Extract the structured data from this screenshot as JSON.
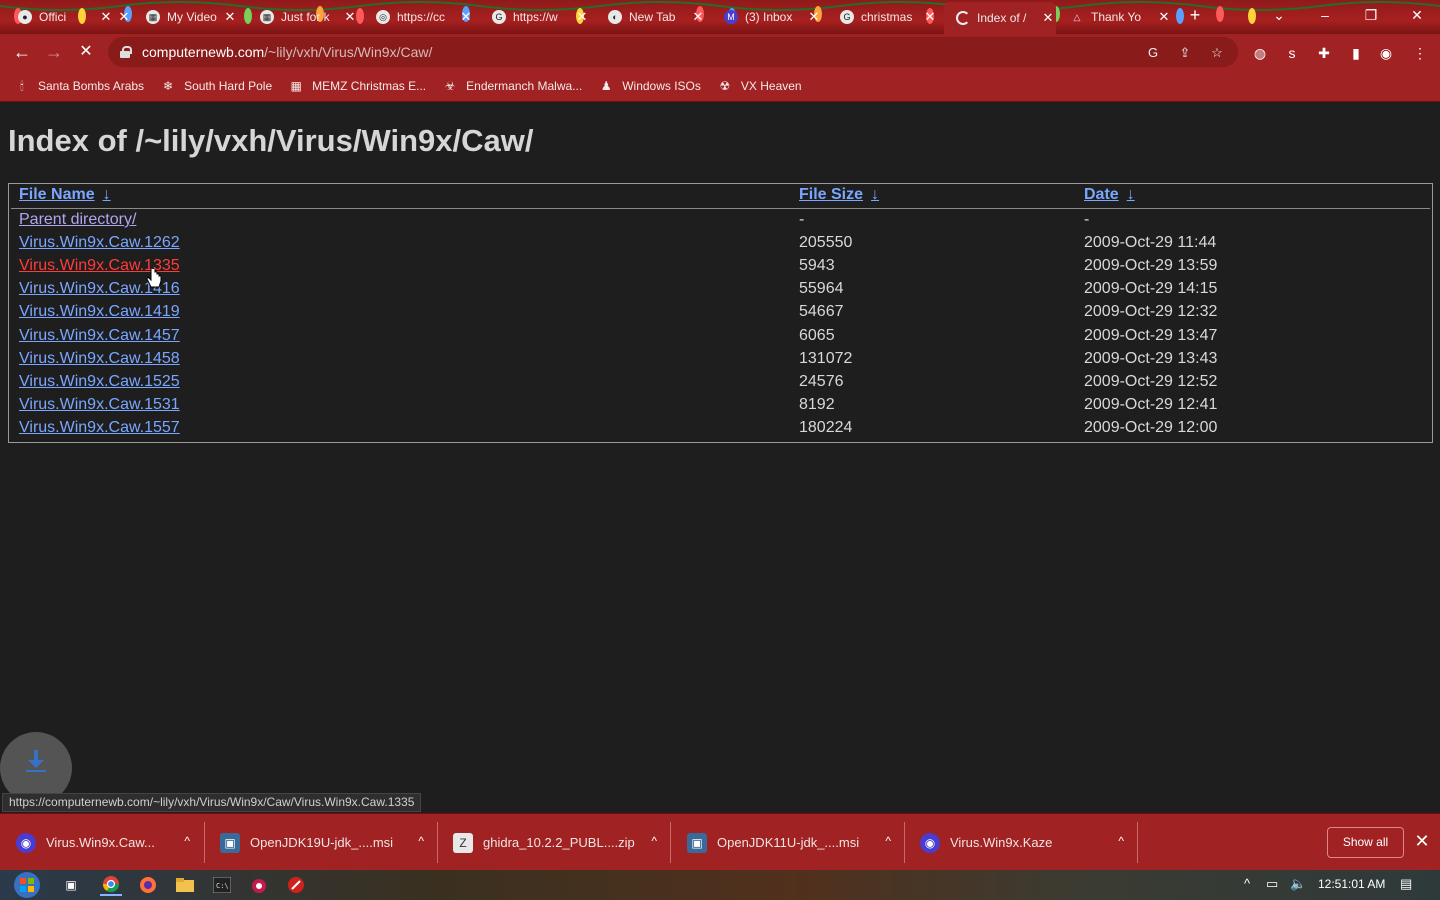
{
  "browser": {
    "tabs": [
      {
        "title": "Offici",
        "close": "✕"
      },
      {
        "title": "",
        "close": "✕"
      },
      {
        "title": "My Video",
        "close": "✕"
      },
      {
        "title": "Just for k",
        "close": "✕"
      },
      {
        "title": "https://cc",
        "close": "✕"
      },
      {
        "title": "https://w",
        "close": "✕"
      },
      {
        "title": "New Tab",
        "close": "✕"
      },
      {
        "title": "(3) Inbox",
        "close": "✕"
      },
      {
        "title": "christmas",
        "close": "✕"
      },
      {
        "title": "Index of /",
        "close": "✕"
      },
      {
        "title": "Thank Yo",
        "close": "✕"
      }
    ],
    "new_tab": "+",
    "window": {
      "tabsearch": "⌄",
      "minimize": "–",
      "restore": "❐",
      "close": "✕"
    },
    "address": {
      "host": "computernewb.com",
      "path": "/~lily/vxh/Virus/Win9x/Caw/"
    },
    "nav": {
      "back": "←",
      "forward": "→",
      "stop": "✕"
    },
    "bookmarks": [
      {
        "label": "Santa Bombs Arabs",
        "icon": "🕯"
      },
      {
        "label": "South Hard Pole",
        "icon": "❄"
      },
      {
        "label": "MEMZ Christmas E...",
        "icon": "▦"
      },
      {
        "label": "Endermanch Malwa...",
        "icon": "☣"
      },
      {
        "label": "Windows ISOs",
        "icon": "♟"
      },
      {
        "label": "VX Heaven",
        "icon": "☢"
      }
    ]
  },
  "page": {
    "title": "Index of /~lily/vxh/Virus/Win9x/Caw/",
    "columns": {
      "name": "File Name",
      "size": "File Size",
      "date": "Date",
      "sort_arrow": "↓"
    },
    "rows": [
      {
        "name": "Parent directory/",
        "size": "-",
        "date": "-",
        "state": "visited"
      },
      {
        "name": "Virus.Win9x.Caw.1262",
        "size": "205550",
        "date": "2009-Oct-29 11:44",
        "state": "normal"
      },
      {
        "name": "Virus.Win9x.Caw.1335",
        "size": "5943",
        "date": "2009-Oct-29 13:59",
        "state": "hover"
      },
      {
        "name": "Virus.Win9x.Caw.1416",
        "size": "55964",
        "date": "2009-Oct-29 14:15",
        "state": "normal"
      },
      {
        "name": "Virus.Win9x.Caw.1419",
        "size": "54667",
        "date": "2009-Oct-29 12:32",
        "state": "normal"
      },
      {
        "name": "Virus.Win9x.Caw.1457",
        "size": "6065",
        "date": "2009-Oct-29 13:47",
        "state": "normal"
      },
      {
        "name": "Virus.Win9x.Caw.1458",
        "size": "131072",
        "date": "2009-Oct-29 13:43",
        "state": "normal"
      },
      {
        "name": "Virus.Win9x.Caw.1525",
        "size": "24576",
        "date": "2009-Oct-29 12:52",
        "state": "normal"
      },
      {
        "name": "Virus.Win9x.Caw.1531",
        "size": "8192",
        "date": "2009-Oct-29 12:41",
        "state": "normal"
      },
      {
        "name": "Virus.Win9x.Caw.1557",
        "size": "180224",
        "date": "2009-Oct-29 12:00",
        "state": "normal"
      }
    ]
  },
  "status_bar": {
    "url": "https://computernewb.com/~lily/vxh/Virus/Win9x/Caw/Virus.Win9x.Caw.1335"
  },
  "downloads": {
    "items": [
      {
        "name": "Virus.Win9x.Caw...",
        "icon": "◉"
      },
      {
        "name": "OpenJDK19U-jdk_....msi",
        "icon": "▣"
      },
      {
        "name": "ghidra_10.2.2_PUBL....zip",
        "icon": "Z"
      },
      {
        "name": "OpenJDK11U-jdk_....msi",
        "icon": "▣"
      },
      {
        "name": "Virus.Win9x.Kaze",
        "icon": "◉"
      }
    ],
    "caret": "^",
    "show_all": "Show all",
    "close": "✕"
  },
  "taskbar": {
    "clock": "12:51:01 AM",
    "tray": {
      "chevron": "^",
      "network": "▭",
      "volume": "🔈",
      "notifications": "▤"
    }
  },
  "colors": {
    "chrome_red": "#a02222",
    "link": "#7aa6ff",
    "link_hover": "#ff3b3b",
    "link_visited": "#b0a6f0",
    "page_bg": "#1e1e1e"
  }
}
